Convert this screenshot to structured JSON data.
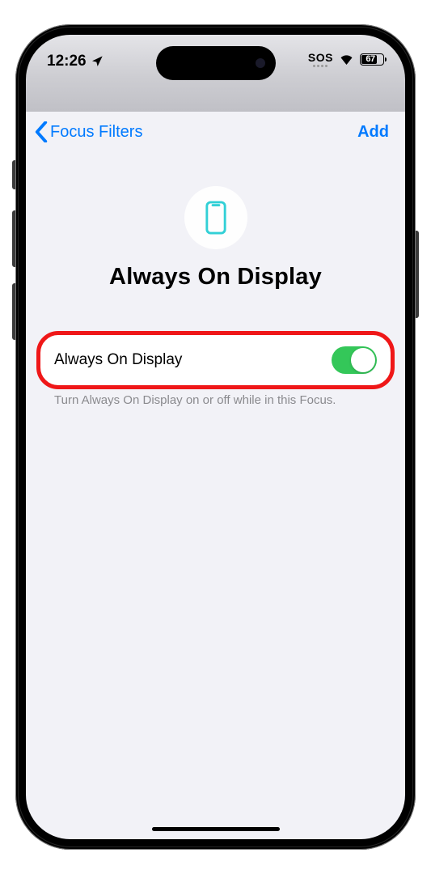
{
  "status_bar": {
    "time": "12:26",
    "sos": "SOS",
    "battery": "67"
  },
  "nav": {
    "back": "Focus Filters",
    "add": "Add"
  },
  "hero": {
    "title": "Always On Display"
  },
  "setting": {
    "label": "Always On Display",
    "toggle_on": true,
    "hint": "Turn Always On Display on or off while in this Focus."
  }
}
